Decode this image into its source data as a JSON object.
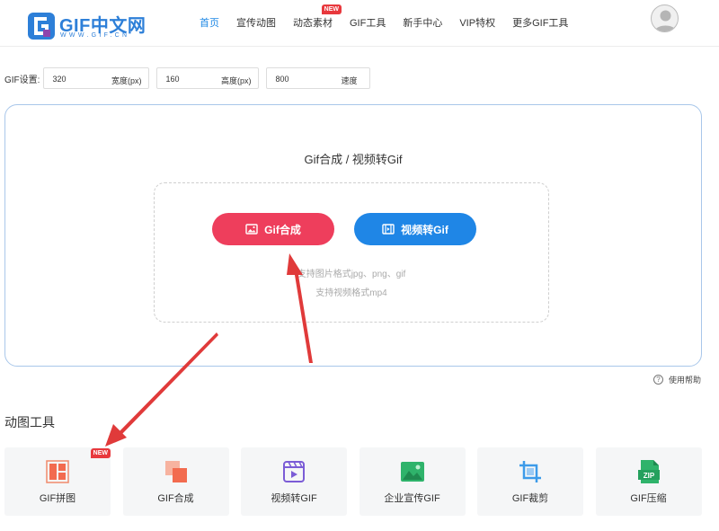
{
  "header": {
    "logo_title": "GIF中文网",
    "logo_sub": "WWW.GIF.CN",
    "nav": [
      {
        "label": "首页",
        "active": true
      },
      {
        "label": "宣传动图"
      },
      {
        "label": "动态素材",
        "badge": "NEW"
      },
      {
        "label": "GIF工具"
      },
      {
        "label": "新手中心"
      },
      {
        "label": "VIP特权"
      },
      {
        "label": "更多GIF工具"
      }
    ]
  },
  "settings": {
    "label": "GIF设置:",
    "width": {
      "value": "320",
      "unit": "宽度(px)"
    },
    "height": {
      "value": "160",
      "unit": "高度(px)"
    },
    "speed": {
      "value": "800",
      "unit": "速度"
    }
  },
  "upload": {
    "title": "Gif合成 / 视频转Gif",
    "gif_button": "Gif合成",
    "video_button": "视频转Gif",
    "hint_images": "支持图片格式jpg、png、gif",
    "hint_video": "支持视频格式mp4"
  },
  "help": {
    "label": "使用帮助",
    "icon": "?"
  },
  "tools_section": {
    "title": "动图工具",
    "badge": "NEW",
    "items": [
      {
        "label": "GIF拼图",
        "icon": "collage-icon"
      },
      {
        "label": "GIF合成",
        "icon": "merge-icon"
      },
      {
        "label": "视频转GIF",
        "icon": "video-icon"
      },
      {
        "label": "企业宣传GIF",
        "icon": "image-icon"
      },
      {
        "label": "GIF裁剪",
        "icon": "crop-icon"
      },
      {
        "label": "GIF压缩",
        "icon": "zip-icon"
      }
    ]
  },
  "colors": {
    "accent_blue": "#1f86e6",
    "accent_red": "#ee3e5c",
    "annotation_arrow": "#e03a3a"
  }
}
